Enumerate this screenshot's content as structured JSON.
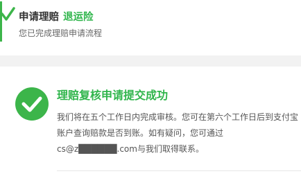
{
  "header": {
    "title_prefix": "申请理赔",
    "title_highlight": "退运险",
    "subtitle": "您已完成理赔申请流程"
  },
  "result": {
    "title": "理赔复核申请提交成功",
    "message": "我们将在五个工作日内完成审核。您可在第六个工作日后到支付宝账户查询赔款是否到账。如有疑问，您可通过cs@z██████.com与我们取得联系。"
  },
  "colors": {
    "accent_green": "#2fb54b",
    "icon_green": "#3cb54a",
    "divider_gray": "#f2f2f2"
  },
  "icons": {
    "header_icon": "checkmark-icon",
    "success_icon": "success-check-icon"
  }
}
